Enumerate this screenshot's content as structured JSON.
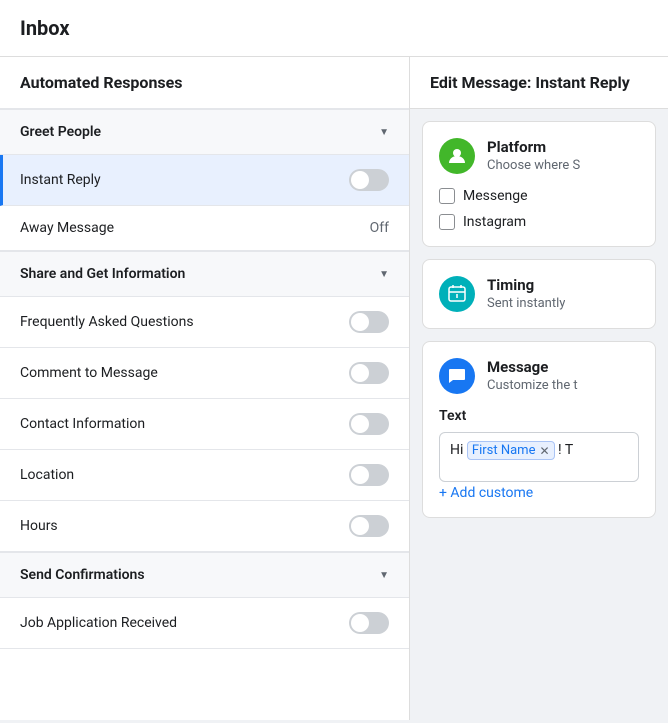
{
  "page": {
    "title": "Inbox"
  },
  "leftPanel": {
    "title": "Automated Responses",
    "sections": [
      {
        "id": "greet-people",
        "label": "Greet People",
        "items": [
          {
            "id": "instant-reply",
            "label": "Instant Reply",
            "control": "toggle",
            "value": false,
            "active": true
          },
          {
            "id": "away-message",
            "label": "Away Message",
            "control": "text",
            "textValue": "Off",
            "active": false
          }
        ]
      },
      {
        "id": "share-get-info",
        "label": "Share and Get Information",
        "items": [
          {
            "id": "faq",
            "label": "Frequently Asked Questions",
            "control": "toggle",
            "value": false,
            "active": false
          },
          {
            "id": "comment-to-message",
            "label": "Comment to Message",
            "control": "toggle",
            "value": false,
            "active": false
          },
          {
            "id": "contact-info",
            "label": "Contact Information",
            "control": "toggle",
            "value": false,
            "active": false
          },
          {
            "id": "location",
            "label": "Location",
            "control": "toggle",
            "value": false,
            "active": false
          },
          {
            "id": "hours",
            "label": "Hours",
            "control": "toggle",
            "value": false,
            "active": false
          }
        ]
      },
      {
        "id": "send-confirmations",
        "label": "Send Confirmations",
        "items": [
          {
            "id": "job-application-received",
            "label": "Job Application Received",
            "control": "toggle",
            "value": false,
            "active": false
          }
        ]
      }
    ]
  },
  "rightPanel": {
    "title": "Edit Message: Instant Reply",
    "cards": [
      {
        "id": "platform-card",
        "iconType": "green",
        "iconGlyph": "👤",
        "title": "Platform",
        "subtitle": "Choose where S",
        "options": [
          {
            "id": "messenger",
            "label": "Messenge"
          },
          {
            "id": "instagram",
            "label": "Instagram"
          }
        ]
      },
      {
        "id": "timing-card",
        "iconType": "teal",
        "iconGlyph": "⏱",
        "title": "Timing",
        "subtitle": "Sent instantly"
      },
      {
        "id": "message-card",
        "iconType": "blue",
        "iconGlyph": "💬",
        "title": "Message",
        "subtitle": "Customize the t",
        "textFieldLabel": "Text",
        "textPrefix": "Hi",
        "tokenLabel": "First Name",
        "textSuffix": "! T",
        "addCustomLabel": "+ Add custome"
      }
    ]
  }
}
